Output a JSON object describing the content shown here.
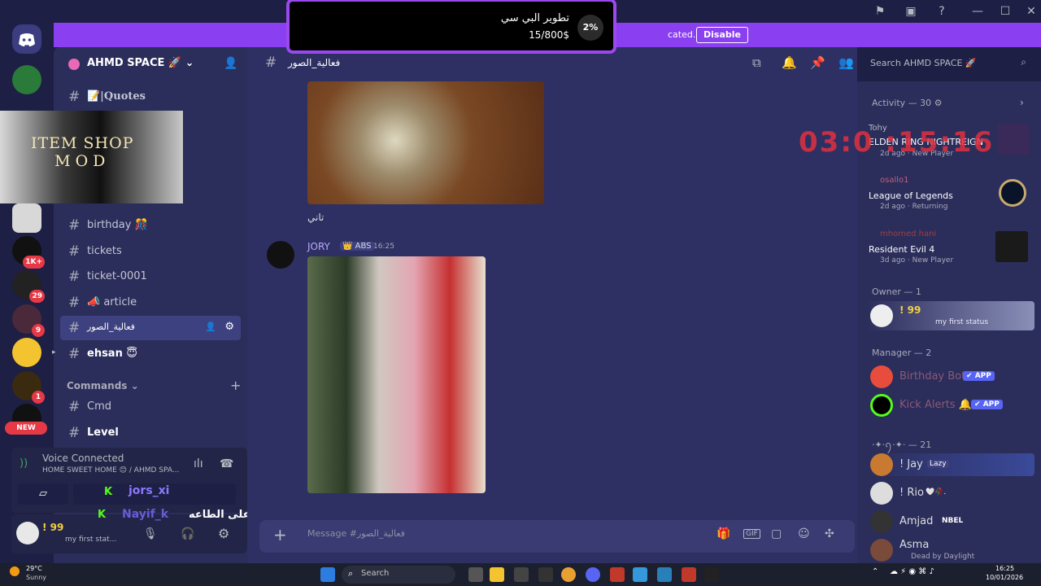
{
  "window": {
    "controls": [
      "—",
      "☐",
      "✕"
    ]
  },
  "banner": {
    "text": "cated.",
    "button": "Disable"
  },
  "overlay": {
    "title": "تطوير البي سي",
    "subtitle": "15/800$",
    "percent": "2%"
  },
  "guild_rail": {
    "badges": [
      "1K+",
      "29",
      "9",
      "1"
    ],
    "new_label": "NEW"
  },
  "server": {
    "name": "AHMD SPACE 🚀"
  },
  "item_shop": {
    "line1": "ITEM SHOP",
    "line2": "MOD"
  },
  "channels": [
    {
      "label": "📝|Quotes"
    },
    {
      "label": "birthday 🎊"
    },
    {
      "label": "tickets"
    },
    {
      "label": "ticket-0001"
    },
    {
      "label": "📣 article"
    },
    {
      "label": "فعالية_الصور",
      "active": true
    },
    {
      "label": "ehsan 😇"
    }
  ],
  "commands_category": {
    "label": "Commands",
    "channels": [
      "Cmd",
      "Level"
    ]
  },
  "voice": {
    "status": "Voice Connected",
    "channel": "HOME SWEET HOME 😊 / AHMD SPA..."
  },
  "overlay_users": [
    "jors_xi",
    "Nayif_k"
  ],
  "overlay_caption": "اللهم امين ويثبتكم جميع على الطاعه",
  "user_panel": {
    "name": "! 99",
    "status": "my first stat..."
  },
  "chat": {
    "channel_name": "فعالية_الصور",
    "message1_text": "تاني",
    "author": "JORY",
    "author_tag": "ABS",
    "time": "16:25",
    "composer_placeholder": "Message #فعالية_الصور"
  },
  "header_search": {
    "placeholder": "Search AHMD SPACE 🚀"
  },
  "timer": "03:0  :15:16",
  "activity": {
    "title": "Activity — 30",
    "items": [
      {
        "user": "Tohy",
        "game": "ELDEN RING NIGHTREIGN",
        "meta": "2d ago",
        "tag": "New Player"
      },
      {
        "user": "osallo1",
        "game": "League of Legends",
        "meta": "2d ago",
        "tag": "Returning"
      },
      {
        "user": "mhomed hani",
        "game": "Resident Evil 4",
        "meta": "3d ago",
        "tag": "New Player"
      }
    ]
  },
  "members": {
    "owner_header": "Owner — 1",
    "owner": {
      "name": "! 99",
      "status": "my first status"
    },
    "manager_header": "Manager — 2",
    "managers": [
      {
        "name": "Birthday Bot",
        "tag": "APP"
      },
      {
        "name": "Kick Alerts 🔔",
        "tag": "APP"
      }
    ],
    "group_header": "·✦·ꪆ·✦· — 21",
    "group": [
      {
        "name": "! Jay",
        "extra": "Lazy"
      },
      {
        "name": "! Rio",
        "extra": "🤍🥀."
      },
      {
        "name": "Amjad",
        "extra": "NBEL"
      },
      {
        "name": "Asma",
        "extra": "Dead by Daylight"
      }
    ]
  },
  "taskbar": {
    "weather_temp": "29°C",
    "weather_desc": "Sunny",
    "search": "Search",
    "time": "16:25",
    "date": "10/01/2026"
  },
  "colors": {
    "accent": "#8a3ff0",
    "app_tag": "#5865f2",
    "sidebar": "#2b2d5b",
    "chat": "#2e3063"
  }
}
